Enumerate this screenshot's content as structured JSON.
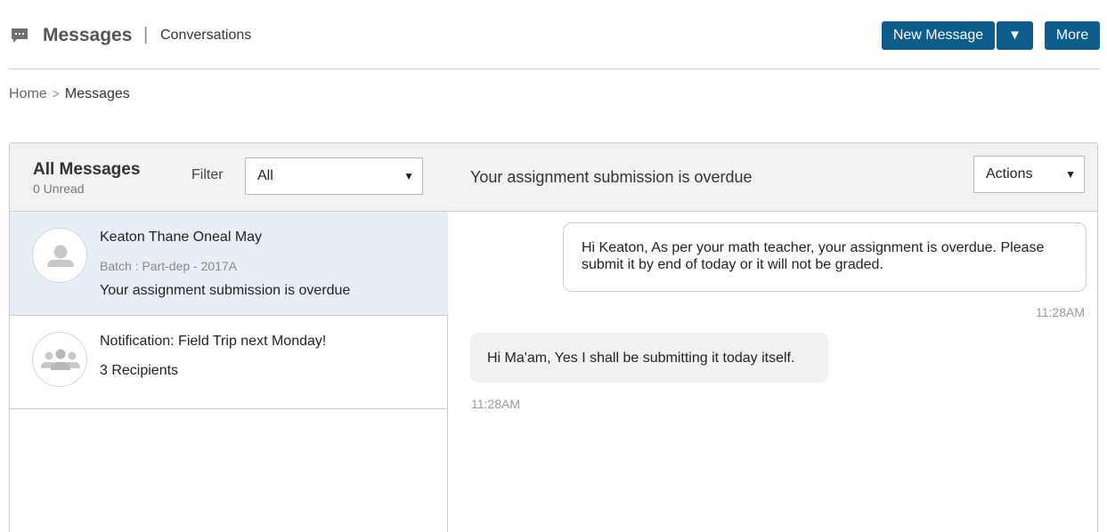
{
  "header": {
    "title": "Messages",
    "separator": "|",
    "subtitle": "Conversations",
    "new_message_label": "New Message",
    "caret_label": "▼",
    "more_label": "More",
    "icon": "chat-bubble-icon"
  },
  "breadcrumb": {
    "home": "Home",
    "separator": ">",
    "current": "Messages"
  },
  "list": {
    "title": "All Messages",
    "unread": "0 Unread",
    "filter_label": "Filter",
    "filter_value": "All",
    "conversations": [
      {
        "name": "Keaton Thane Oneal May",
        "meta": "Batch : Part-dep - 2017A",
        "snippet": "Your assignment submission is overdue",
        "icon": "user-avatar-icon",
        "selected": true
      },
      {
        "name": "Notification: Field Trip next Monday!",
        "meta": "",
        "snippet": "3 Recipients",
        "icon": "group-avatar-icon",
        "selected": false
      }
    ]
  },
  "thread": {
    "subject": "Your assignment submission is overdue",
    "actions_label": "Actions",
    "messages": [
      {
        "direction": "outgoing",
        "text": "Hi Keaton, As per your math teacher, your assignment is overdue. Please submit it by end of today or it will not be graded.",
        "time": "11:28AM"
      },
      {
        "direction": "incoming",
        "text": "Hi Ma'am, Yes I shall be submitting it today itself.",
        "time": "11:28AM"
      }
    ]
  },
  "colors": {
    "primary_button": "#0d5c8c",
    "selected_row": "#e8eef8",
    "header_bar": "#f2f2f2"
  }
}
